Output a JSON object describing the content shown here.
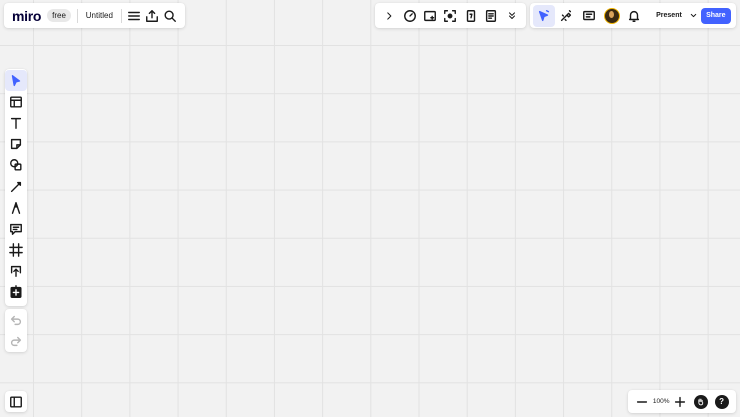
{
  "app": {
    "logo": "miro",
    "plan_badge": "free",
    "board_title": "Untitled"
  },
  "board_panel": {
    "icons": [
      "menu-icon",
      "upload-icon",
      "search-icon"
    ]
  },
  "top_tools": {
    "icons": [
      "chevron-right-icon",
      "timer-icon",
      "sticky-add-icon",
      "focus-icon",
      "card-icon",
      "notes-icon",
      "double-chevron-down-icon"
    ]
  },
  "collaboration": {
    "icons": [
      "cursor-follow-icon",
      "reactions-icon",
      "comments-icon",
      "avatar",
      "bell-icon"
    ],
    "present_label": "Present",
    "share_label": "Share",
    "accent": "#4262ff"
  },
  "left_toolbar": {
    "tools": [
      "select-icon",
      "templates-icon",
      "text-icon",
      "sticky-note-icon",
      "shapes-icon",
      "pen-line-icon",
      "pen-icon",
      "comment-icon",
      "frame-icon",
      "upload-add-icon",
      "plus-square-icon"
    ]
  },
  "history": {
    "undo": "undo-icon",
    "redo": "redo-icon"
  },
  "zoom": {
    "value": "100%",
    "help_label": "?"
  }
}
